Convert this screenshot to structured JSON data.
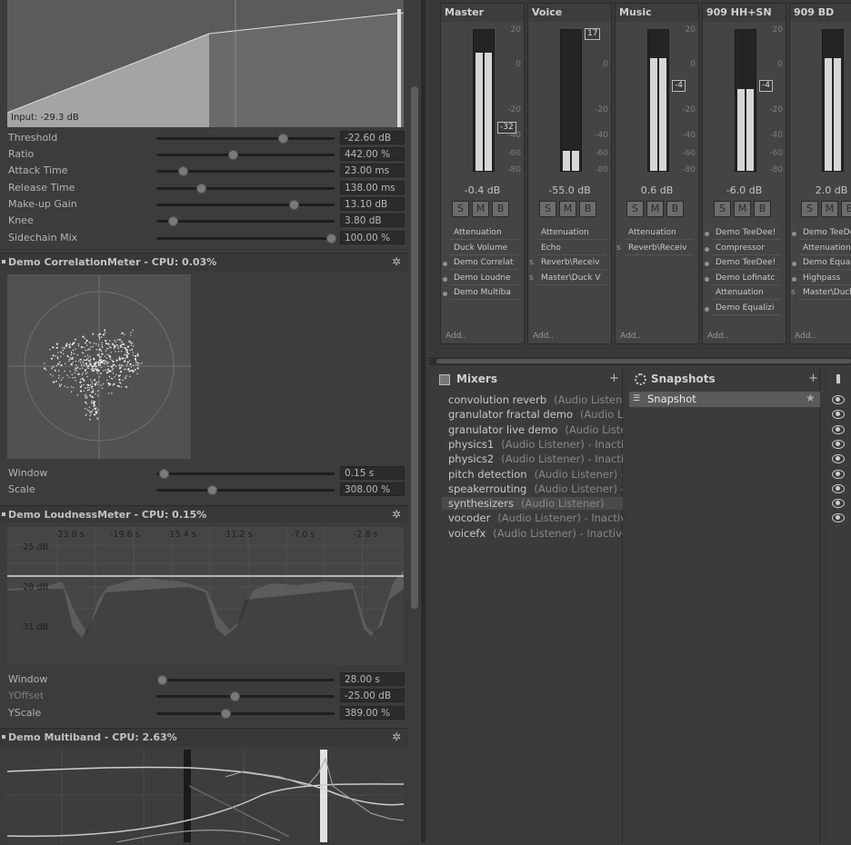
{
  "compressor": {
    "input_label": "Input: -29.3 dB",
    "params": [
      {
        "label": "Threshold",
        "value": "-22.60 dB",
        "pos": 0.71
      },
      {
        "label": "Ratio",
        "value": "442.00 %",
        "pos": 0.43
      },
      {
        "label": "Attack Time",
        "value": "23.00 ms",
        "pos": 0.15
      },
      {
        "label": "Release Time",
        "value": "138.00 ms",
        "pos": 0.25
      },
      {
        "label": "Make-up Gain",
        "value": "13.10 dB",
        "pos": 0.77
      },
      {
        "label": "Knee",
        "value": "3.80 dB",
        "pos": 0.09
      },
      {
        "label": "Sidechain Mix",
        "value": "100.00 %",
        "pos": 1.0
      }
    ]
  },
  "correlation": {
    "header": "Demo CorrelationMeter - CPU: 0.03%",
    "params": [
      {
        "label": "Window",
        "value": "0.15 s",
        "pos": 0.04
      },
      {
        "label": "Scale",
        "value": "308.00 %",
        "pos": 0.31
      }
    ]
  },
  "loudness": {
    "header": "Demo LoudnessMeter - CPU: 0.15%",
    "time_ticks": [
      "-23.8 s",
      "-19.6 s",
      "-15.4 s",
      "-11.2 s",
      "-7.0 s",
      "-2.8 s"
    ],
    "db_labels": [
      "-25 dB",
      "-28 dB",
      "-31 dB"
    ],
    "params": [
      {
        "label": "Window",
        "value": "28.00 s",
        "pos": 0.03
      },
      {
        "label": "YOffset",
        "value": "-25.00 dB",
        "pos": 0.44
      },
      {
        "label": "YScale",
        "value": "389.00 %",
        "pos": 0.39
      }
    ]
  },
  "multiband": {
    "header": "Demo Multiband - CPU: 2.63%"
  },
  "strips": [
    {
      "name": "Master",
      "db": "-0.4 dB",
      "level": 0.84,
      "tag": "-32",
      "scale": [
        "20",
        "0",
        "-20",
        "-40",
        "-60",
        "-80"
      ],
      "effects": [
        {
          "label": "Attenuation",
          "mark": ""
        },
        {
          "label": "Duck Volume",
          "mark": ""
        },
        {
          "label": "Demo Correlat",
          "mark": "dot"
        },
        {
          "label": "Demo Loudne",
          "mark": "dot"
        },
        {
          "label": "Demo Multiba",
          "mark": "dot"
        }
      ],
      "add": "Add.."
    },
    {
      "name": "Voice",
      "db": "-55.0 dB",
      "level": 0.14,
      "tag": "17",
      "scale": [
        "",
        "0",
        "-20",
        "-40",
        "-60",
        "-80"
      ],
      "effects": [
        {
          "label": "Attenuation",
          "mark": ""
        },
        {
          "label": "Echo",
          "mark": ""
        },
        {
          "label": "Reverb\\Receiv",
          "mark": "s"
        },
        {
          "label": "Master\\Duck V",
          "mark": "s"
        }
      ],
      "add": "Add.."
    },
    {
      "name": "Music",
      "db": "0.6 dB",
      "level": 0.8,
      "tag": "-4",
      "scale": [
        "20",
        "0",
        "-20",
        "-40",
        "-60",
        "-80"
      ],
      "effects": [
        {
          "label": "Attenuation",
          "mark": ""
        },
        {
          "label": "Reverb\\Receiv",
          "mark": "s"
        }
      ],
      "add": "Add.."
    },
    {
      "name": "909 HH+SN",
      "db": "-6.0 dB",
      "level": 0.58,
      "tag": "-4",
      "scale": [
        "20",
        "0",
        "-20",
        "-40",
        "-60",
        "-80"
      ],
      "effects": [
        {
          "label": "Demo TeeDee!",
          "mark": "dot"
        },
        {
          "label": "Compressor",
          "mark": "dot"
        },
        {
          "label": "Demo TeeDee!",
          "mark": "dot"
        },
        {
          "label": "Demo Lofinatc",
          "mark": "dot"
        },
        {
          "label": "Attenuation",
          "mark": ""
        },
        {
          "label": "Demo Equalizi",
          "mark": "dot"
        }
      ],
      "add": "Add.."
    },
    {
      "name": "909 BD",
      "db": "2.0 dB",
      "level": 0.8,
      "tag": "",
      "scale": [
        "20",
        "0",
        "-20",
        "-40",
        "-60",
        "-80"
      ],
      "effects": [
        {
          "label": "Demo TeeDee",
          "mark": "dot"
        },
        {
          "label": "Attenuation",
          "mark": ""
        },
        {
          "label": "Demo Equal",
          "mark": "dot"
        },
        {
          "label": "Highpass",
          "mark": "dot"
        },
        {
          "label": "Master\\Duck",
          "mark": "s"
        }
      ],
      "add": "Add.."
    }
  ],
  "strip_buttons": [
    "S",
    "M",
    "B"
  ],
  "mixers": {
    "title": "Mixers",
    "add": "+",
    "items": [
      {
        "name": "convolution reverb",
        "sub": "(Audio Listen"
      },
      {
        "name": "granulator fractal demo",
        "sub": "(Audio Li"
      },
      {
        "name": "granulator live demo",
        "sub": "(Audio Liste"
      },
      {
        "name": "physics1",
        "sub": "(Audio Listener) - Inacti"
      },
      {
        "name": "physics2",
        "sub": "(Audio Listener) - Inacti"
      },
      {
        "name": "pitch detection",
        "sub": "(Audio Listener) -"
      },
      {
        "name": "speakerrouting",
        "sub": "(Audio Listener) -"
      },
      {
        "name": "synthesizers",
        "sub": "(Audio Listener)"
      },
      {
        "name": "vocoder",
        "sub": "(Audio Listener) - Inactiv"
      },
      {
        "name": "voicefx",
        "sub": "(Audio Listener) - Inactive"
      }
    ]
  },
  "snapshots": {
    "title": "Snapshots",
    "add": "+",
    "items": [
      "Snapshot"
    ]
  },
  "colors": {
    "panel": "#3c3c3c",
    "meter": "#d6d6d6",
    "accent": "#4a4a4a"
  }
}
